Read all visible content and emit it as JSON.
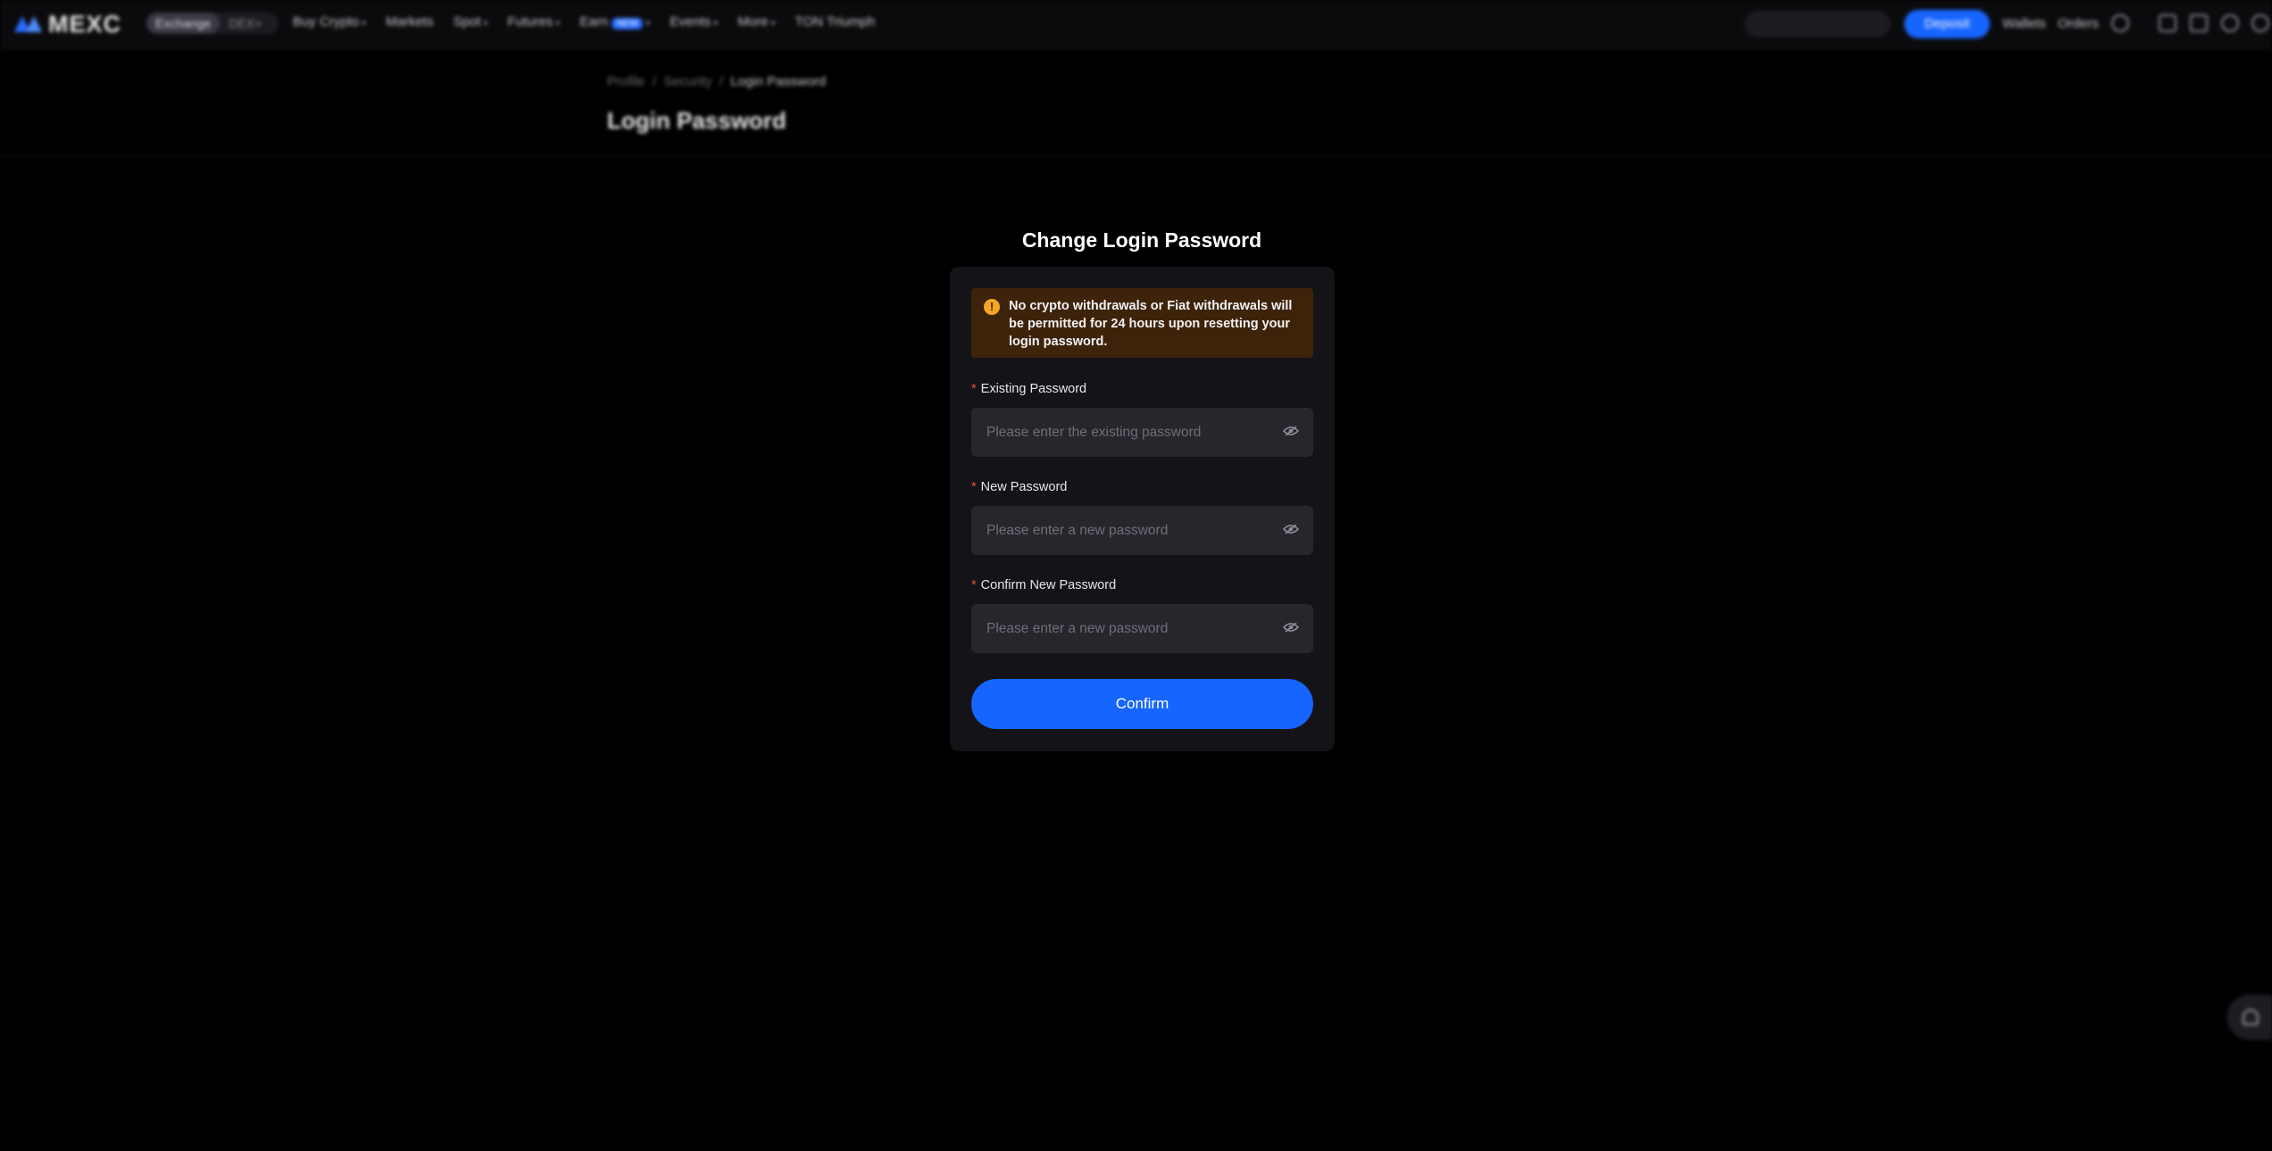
{
  "header": {
    "logo_text": "MEXC",
    "segment": [
      "Exchange",
      "DEX+"
    ],
    "nav": [
      "Buy Crypto",
      "Markets",
      "Spot",
      "Futures",
      "Earn",
      "Events",
      "More",
      "TON Triumph"
    ],
    "earn_badge": "NEW",
    "deposit_label": "Deposit",
    "wallets_label": "Wallets",
    "orders_label": "Orders"
  },
  "breadcrumb": [
    "Profile",
    "Security",
    "Login Password"
  ],
  "page_title": "Login Password",
  "dialog": {
    "title": "Change Login Password",
    "warning": "No crypto withdrawals or Fiat withdrawals will be permitted for 24 hours upon resetting your login password.",
    "fields": [
      {
        "label": "Existing Password",
        "placeholder": "Please enter the existing password"
      },
      {
        "label": "New Password",
        "placeholder": "Please enter a new password"
      },
      {
        "label": "Confirm New Password",
        "placeholder": "Please enter a new password"
      }
    ],
    "required_mark": "*",
    "confirm_label": "Confirm"
  },
  "colors": {
    "accent": "#1665ff",
    "warning_bg": "#3e230b",
    "warning_icon": "#f5a623",
    "required": "#e5533c"
  }
}
